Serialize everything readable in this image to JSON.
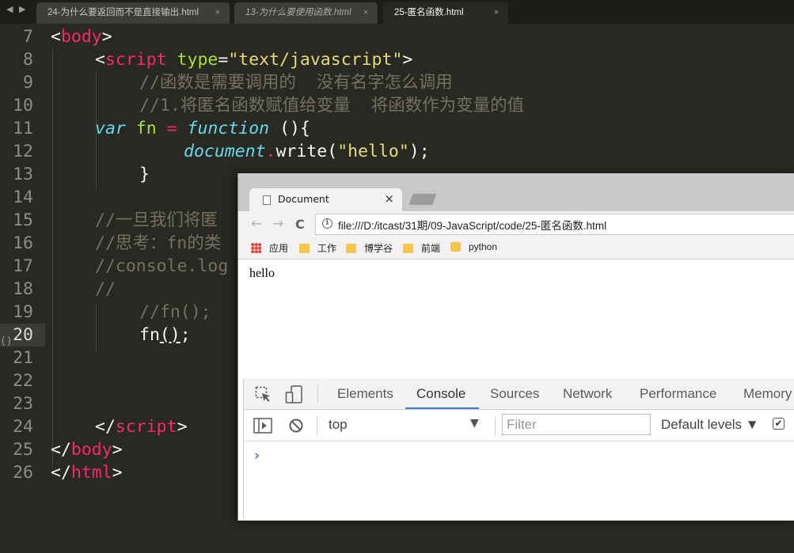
{
  "editor_tabs": [
    {
      "label": "24-为什么要返回而不是直接输出.html",
      "close": "×",
      "style": "normal"
    },
    {
      "label": "13-为什么要使用函数.html",
      "close": "×",
      "style": "italic"
    },
    {
      "label": "25-匿名函数.html",
      "close": "×",
      "style": "active"
    }
  ],
  "nav_arrows": {
    "back": "◀",
    "forward": "▶"
  },
  "lines": [
    {
      "n": "7"
    },
    {
      "n": "8"
    },
    {
      "n": "9"
    },
    {
      "n": "10"
    },
    {
      "n": "11"
    },
    {
      "n": "12"
    },
    {
      "n": "13"
    },
    {
      "n": "14"
    },
    {
      "n": "15"
    },
    {
      "n": "16"
    },
    {
      "n": "17"
    },
    {
      "n": "18"
    },
    {
      "n": "19"
    },
    {
      "n": "20"
    },
    {
      "n": "21"
    },
    {
      "n": "22"
    },
    {
      "n": "23"
    },
    {
      "n": "24"
    },
    {
      "n": "25"
    },
    {
      "n": "26"
    }
  ],
  "code": {
    "l7": {
      "lt": "<",
      "tag": "body",
      "gt": ">"
    },
    "l8": {
      "lt": "<",
      "tag": "script",
      "attr": "type",
      "eq": "=",
      "val": "\"text/javascript\"",
      "gt": ">"
    },
    "l9": {
      "comment": "//函数是需要调用的  没有名字怎么调用"
    },
    "l10": {
      "comment": "//1.将匿名函数赋值给变量  将函数作为变量的值"
    },
    "l11": {
      "kw": "var",
      "name": "fn",
      "op": "=",
      "fnkw": "function",
      "rest": "(){"
    },
    "l12": {
      "obj": "document",
      "dot": ".",
      "method": "write(",
      "str": "\"hello\"",
      "end": ");"
    },
    "l13": {
      "brace": "}"
    },
    "l15": {
      "comment": "//一旦我们将匿"
    },
    "l16": {
      "comment": "//思考：fn的类"
    },
    "l17": {
      "comment": "//console.log"
    },
    "l18": {
      "comment": "//"
    },
    "l19": {
      "comment": "//fn();"
    },
    "l20": {
      "name": "fn",
      "call": "()",
      "end": ";"
    },
    "l24": {
      "lt": "</",
      "tag": "script",
      "gt": ">"
    },
    "l25": {
      "lt": "</",
      "tag": "body",
      "gt": ">"
    },
    "l26": {
      "lt": "</",
      "tag": "html",
      "gt": ">"
    }
  },
  "fold_marker": "()",
  "browser": {
    "tab_title": "Document",
    "tab_close": "×",
    "nav": {
      "back": "←",
      "forward": "→",
      "reload": "C"
    },
    "info_icon": "i",
    "url": "file:///D:/itcast/31期/09-JavaScript/code/25-匿名函数.html",
    "bookmarks": [
      "应用",
      "工作",
      "博学谷",
      "前端",
      "python"
    ],
    "page_text": "hello"
  },
  "devtools": {
    "tabs": [
      "Elements",
      "Console",
      "Sources",
      "Network",
      "Performance",
      "Memory"
    ],
    "active_tab": "Console",
    "context": "top",
    "context_arrow": "▼",
    "filter_placeholder": "Filter",
    "levels": "Default levels ▼",
    "checkbox": "✔",
    "prompt": "›"
  },
  "colors": {
    "editor_bg": "#282923",
    "tag": "#f92672",
    "attr": "#a6e22e",
    "string": "#e6db74",
    "comment": "#75715e",
    "keyword": "#66d9ef",
    "devtools_accent": "#3b78e7"
  }
}
